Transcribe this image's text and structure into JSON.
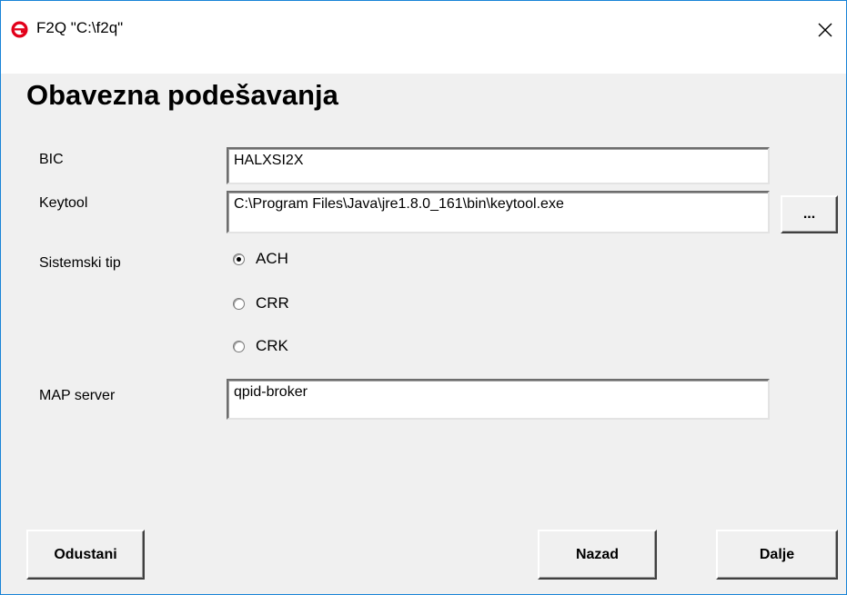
{
  "window": {
    "title": "F2Q \"C:\\f2q\"",
    "close_icon": "close-icon",
    "app_icon": "app-e-icon",
    "accent": "#e2001a"
  },
  "page": {
    "heading": "Obavezna podešavanja"
  },
  "form": {
    "bic_label": "BIC",
    "bic_value": "HALXSI2X",
    "keytool_label": "Keytool",
    "keytool_value": "C:\\Program Files\\Java\\jre1.8.0_161\\bin\\keytool.exe",
    "browse_label": "...",
    "system_type_label": "Sistemski tip",
    "system_type_options": [
      {
        "label": "ACH",
        "checked": true
      },
      {
        "label": "CRR",
        "checked": false
      },
      {
        "label": "CRK",
        "checked": false
      }
    ],
    "map_server_label": "MAP server",
    "map_server_value": "qpid-broker"
  },
  "buttons": {
    "cancel": "Odustani",
    "back": "Nazad",
    "next": "Dalje"
  }
}
